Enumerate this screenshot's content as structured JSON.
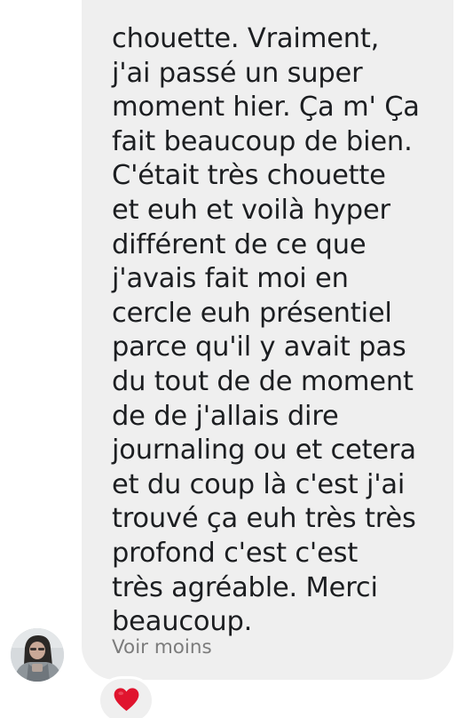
{
  "message": {
    "partial_top_line": "…",
    "lines": [
      "chouette. Vraiment,",
      "j'ai passé un super",
      "moment hier. Ça m' Ça",
      "fait beaucoup de bien.",
      "C'était très chouette",
      "et euh et voilà hyper",
      "différent de ce que",
      "j'avais fait moi en",
      "cercle euh présentiel",
      "parce qu'il y avait pas",
      "du tout de de moment",
      "de de j'allais dire",
      "journaling ou et cetera",
      "et du coup là c'est j'ai",
      "trouvé ça euh très très",
      "profond c'est c'est",
      "très agréable. Merci",
      "beaucoup."
    ],
    "see_less_label": "Voir moins"
  },
  "sender": {
    "avatar_icon": "user-avatar"
  },
  "reaction": {
    "emoji_icon": "red-heart-icon",
    "color": "#e0142e"
  },
  "colors": {
    "bubble": "#efefef",
    "text": "#1c1e21",
    "secondary_text": "#7c7c7c"
  }
}
